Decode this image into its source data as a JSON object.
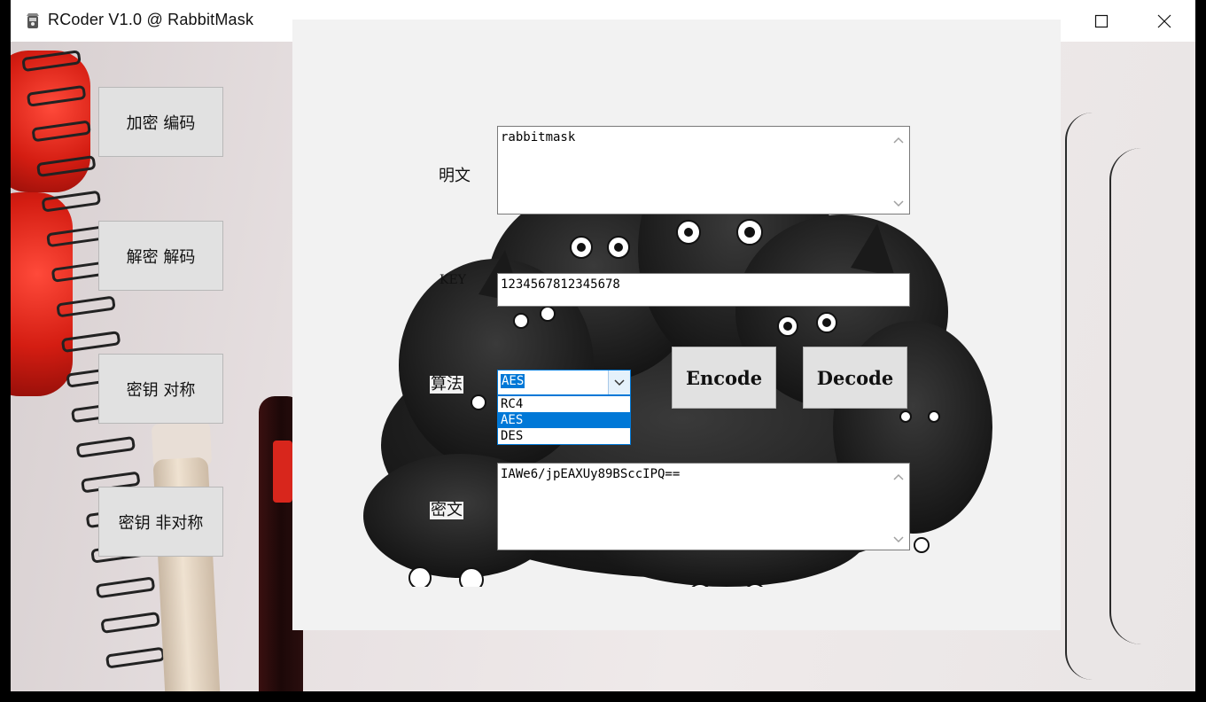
{
  "window": {
    "title": "RCoder V1.0 @ RabbitMask",
    "minimize_icon": "minimize-icon",
    "maximize_icon": "maximize-icon",
    "close_icon": "close-icon"
  },
  "sidebar": {
    "items": [
      {
        "label": "加密 编码"
      },
      {
        "label": "解密 解码"
      },
      {
        "label": "密钥 对称"
      },
      {
        "label": "密钥 非对称"
      }
    ]
  },
  "form": {
    "plaintext_label": "明文",
    "plaintext_value": "rabbitmask",
    "key_label": "KEY",
    "key_value": "1234567812345678",
    "algorithm_label": "算法",
    "algorithm_selected": "AES",
    "algorithm_options": [
      "RC4",
      "AES",
      "DES"
    ],
    "ciphertext_label": "密文",
    "ciphertext_value": "IAWe6/jpEAXUy89BSccIPQ=="
  },
  "actions": {
    "encode_label": "Encode",
    "decode_label": "Decode"
  },
  "colors": {
    "selection": "#0078d7",
    "button_bg": "#e1e1e1",
    "panel_bg": "#f2f2f2"
  }
}
